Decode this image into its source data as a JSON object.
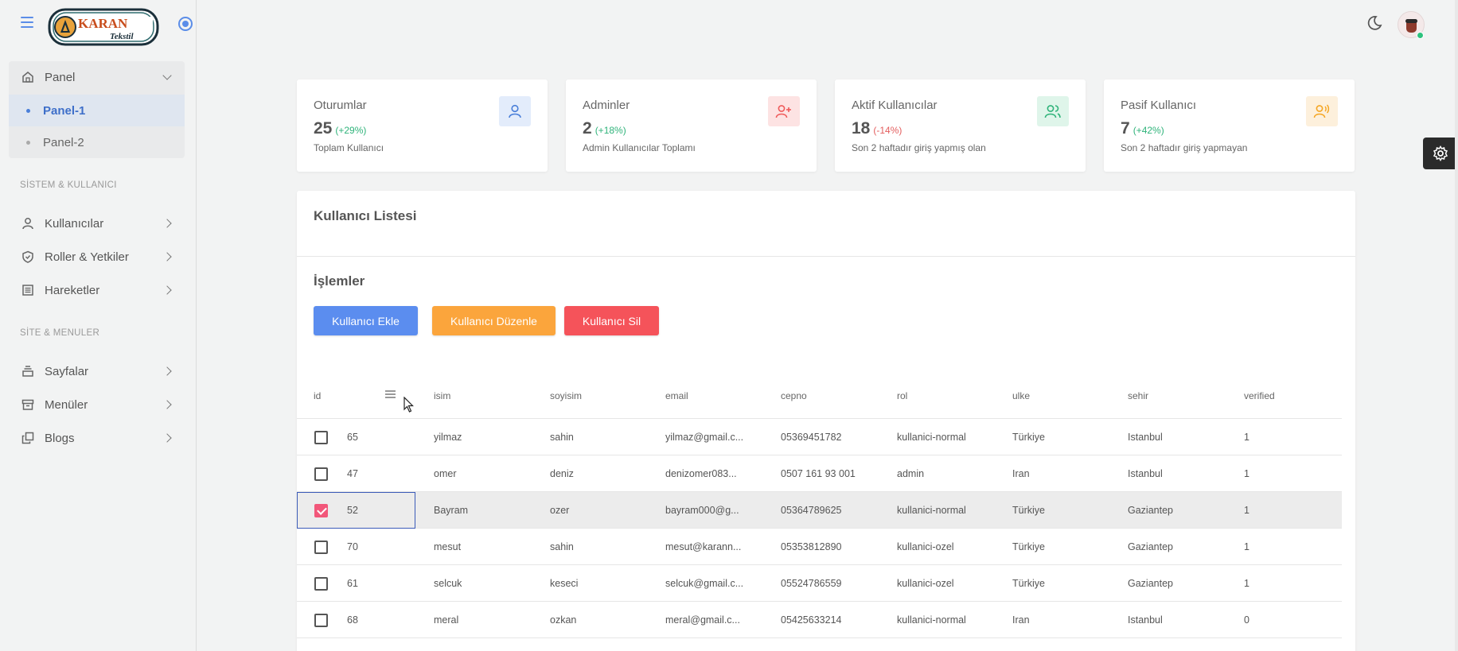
{
  "brand": {
    "logo_top": "KARAN",
    "logo_bottom": "Tekstil"
  },
  "sidebar": {
    "panel": {
      "label": "Panel",
      "children": [
        "Panel-1",
        "Panel-2"
      ]
    },
    "section1": "SİSTEM & KULLANICI",
    "items1": [
      {
        "label": "Kullanıcılar",
        "icon": "user-icon"
      },
      {
        "label": "Roller & Yetkiler",
        "icon": "shield-icon"
      },
      {
        "label": "Hareketler",
        "icon": "list-icon"
      }
    ],
    "section2": "SİTE & MENULER",
    "items2": [
      {
        "label": "Sayfalar",
        "icon": "pages-icon"
      },
      {
        "label": "Menüler",
        "icon": "archive-icon"
      },
      {
        "label": "Blogs",
        "icon": "copy-icon"
      }
    ]
  },
  "stats": [
    {
      "title": "Oturumlar",
      "value": "25",
      "pct": "(+29%)",
      "desc": "Toplam Kullanıcı",
      "icon": "user-icon",
      "color": "#4a7fd9"
    },
    {
      "title": "Adminler",
      "value": "2",
      "pct": "(+18%)",
      "desc": "Admin Kullanıcılar Toplamı",
      "icon": "user-plus-icon",
      "color": "#ef5b5b"
    },
    {
      "title": "Aktif Kullanıcılar",
      "value": "18",
      "pct": "(-14%)",
      "desc": "Son 2 haftadır giriş yapmış olan",
      "icon": "users-icon",
      "color": "#2fb37a"
    },
    {
      "title": "Pasif Kullanıcı",
      "value": "7",
      "pct": "(+42%)",
      "desc": "Son 2 haftadır giriş yapmayan",
      "icon": "user-voice-icon",
      "color": "#f5a623"
    }
  ],
  "card": {
    "title": "Kullanıcı Listesi",
    "ops_title": "İşlemler",
    "buttons": {
      "add": "Kullanıcı Ekle",
      "edit": "Kullanıcı Düzenle",
      "delete": "Kullanıcı Sil"
    }
  },
  "table": {
    "columns": [
      "id",
      "isim",
      "soyisim",
      "email",
      "cepno",
      "rol",
      "ulke",
      "sehir",
      "verified"
    ],
    "rows": [
      {
        "checked": false,
        "id": "65",
        "isim": "yilmaz",
        "soyisim": "sahin",
        "email": "yilmaz@gmail.c...",
        "cepno": "05369451782",
        "rol": "kullanici-normal",
        "ulke": "Türkiye",
        "sehir": "Istanbul",
        "verified": "1"
      },
      {
        "checked": false,
        "id": "47",
        "isim": "omer",
        "soyisim": "deniz",
        "email": "denizomer083...",
        "cepno": "0507 161 93 001",
        "rol": "admin",
        "ulke": "Iran",
        "sehir": "Istanbul",
        "verified": "1"
      },
      {
        "checked": true,
        "id": "52",
        "isim": "Bayram",
        "soyisim": "ozer",
        "email": "bayram000@g...",
        "cepno": "05364789625",
        "rol": "kullanici-normal",
        "ulke": "Türkiye",
        "sehir": "Gaziantep",
        "verified": "1"
      },
      {
        "checked": false,
        "id": "70",
        "isim": "mesut",
        "soyisim": "sahin",
        "email": "mesut@karann...",
        "cepno": "05353812890",
        "rol": "kullanici-ozel",
        "ulke": "Türkiye",
        "sehir": "Gaziantep",
        "verified": "1"
      },
      {
        "checked": false,
        "id": "61",
        "isim": "selcuk",
        "soyisim": "keseci",
        "email": "selcuk@gmail.c...",
        "cepno": "05524786559",
        "rol": "kullanici-ozel",
        "ulke": "Türkiye",
        "sehir": "Gaziantep",
        "verified": "1"
      },
      {
        "checked": false,
        "id": "68",
        "isim": "meral",
        "soyisim": "ozkan",
        "email": "meral@gmail.c...",
        "cepno": "05425633214",
        "rol": "kullanici-normal",
        "ulke": "Iran",
        "sehir": "Istanbul",
        "verified": "0"
      }
    ]
  },
  "colors": {
    "accent": "#4a7fd9",
    "add": "#5b8def",
    "edit": "#fba53c",
    "delete": "#f5535a",
    "up": "#2fb37a",
    "down": "#e35d5d"
  }
}
